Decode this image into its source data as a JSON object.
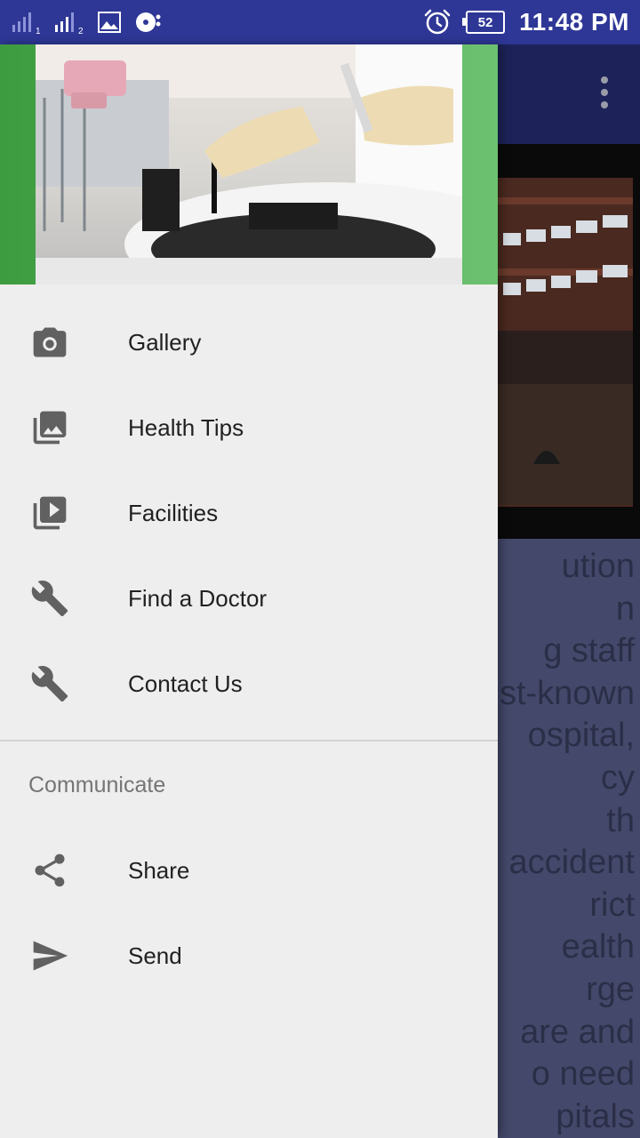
{
  "status_bar": {
    "sim1_label": "1",
    "sim2_label": "2",
    "battery_level": "52",
    "time": "11:48 PM",
    "background_color": "#2e3796"
  },
  "background_screen": {
    "partial_text_lines": [
      "ution",
      "n",
      "g staff",
      "st-known",
      "ospital,",
      "cy",
      "th",
      "accident",
      "rict",
      "ealth",
      "rge",
      "are and",
      "o need",
      "pitals"
    ],
    "toolbar_color": "#1d2359"
  },
  "drawer": {
    "header_color": "#4caf50",
    "items": [
      {
        "label": "Gallery",
        "icon": "camera-icon"
      },
      {
        "label": "Health Tips",
        "icon": "photo-library-icon"
      },
      {
        "label": "Facilities",
        "icon": "video-library-icon"
      },
      {
        "label": "Find a Doctor",
        "icon": "wrench-icon"
      },
      {
        "label": "Contact Us",
        "icon": "wrench-icon"
      }
    ],
    "section_title": "Communicate",
    "section_items": [
      {
        "label": "Share",
        "icon": "share-icon"
      },
      {
        "label": "Send",
        "icon": "send-icon"
      }
    ]
  }
}
